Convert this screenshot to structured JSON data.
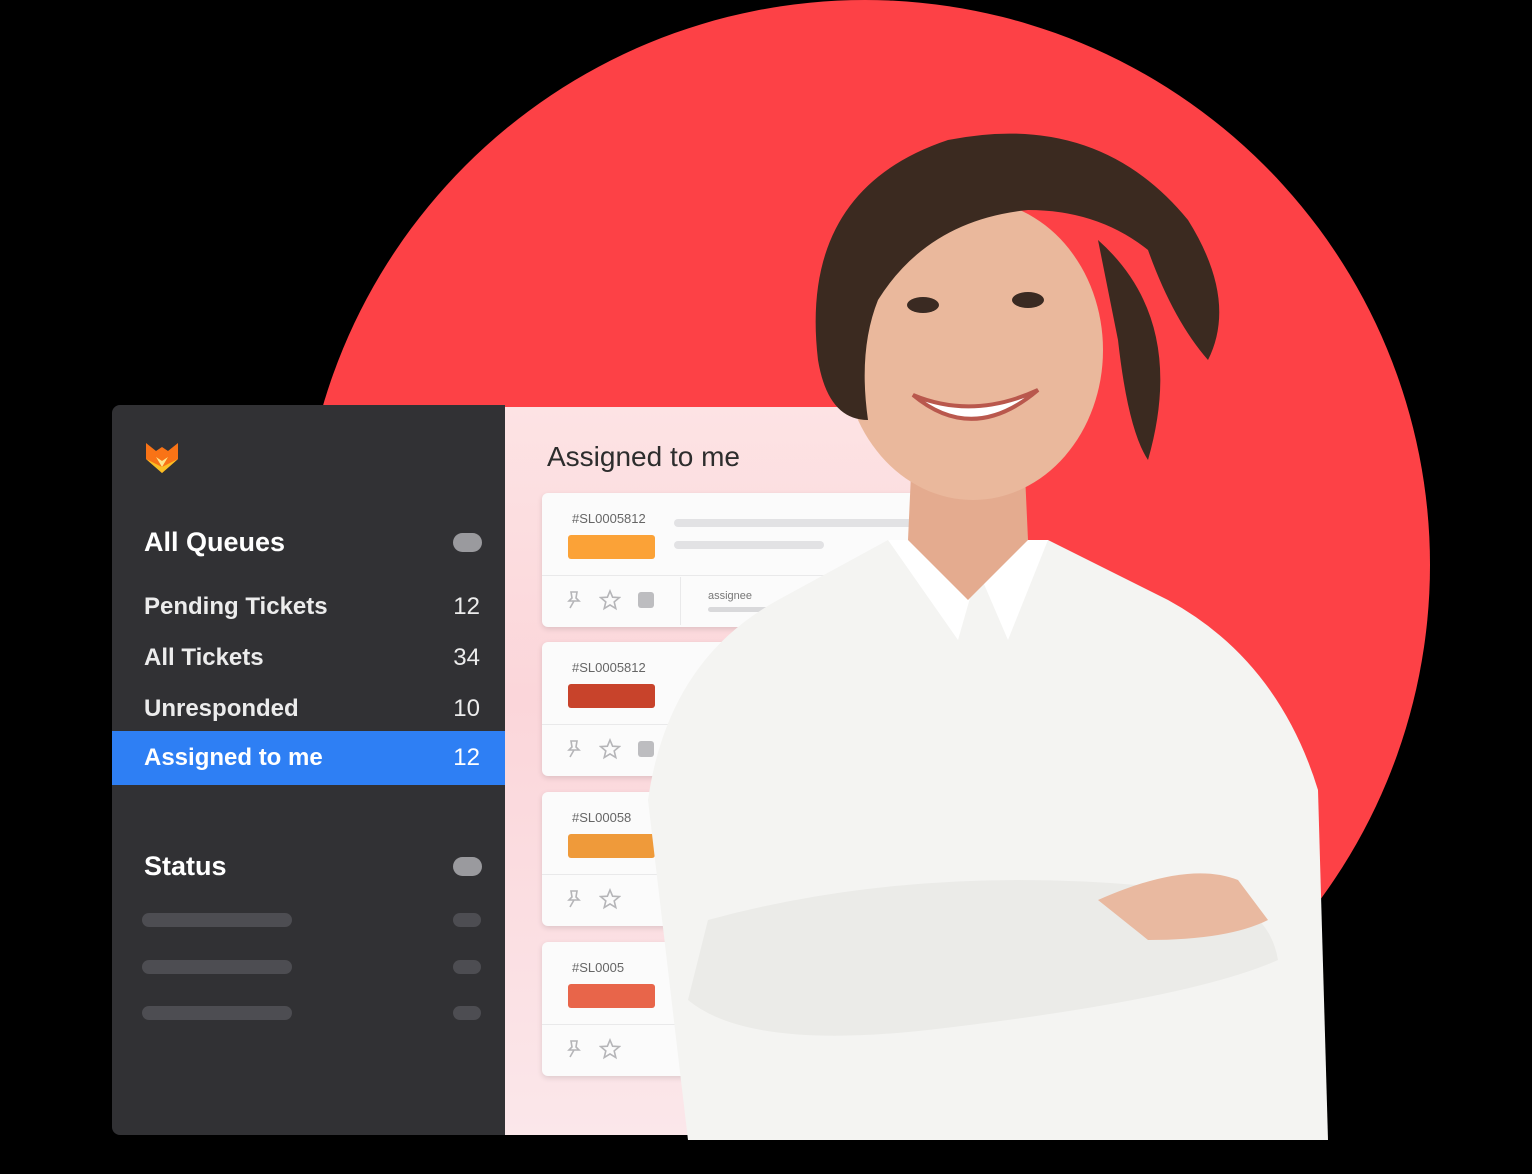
{
  "colors": {
    "accent_circle": "#fd4146",
    "sidebar_bg": "#313134",
    "active_item": "#2e7ff4",
    "priority_colors": [
      "#fba237",
      "#c8432b",
      "#ef9a3a",
      "#e8654a"
    ]
  },
  "sidebar": {
    "logo": "fox-logo-icon",
    "queues_title": "All Queues",
    "items": [
      {
        "label": "Pending Tickets",
        "count": "12"
      },
      {
        "label": "All Tickets",
        "count": "34"
      },
      {
        "label": "Unresponded",
        "count": "10"
      },
      {
        "label": "Assigned to me",
        "count": "12",
        "active": true
      }
    ],
    "status_title": "Status"
  },
  "main": {
    "title": "Assigned to me",
    "tickets": [
      {
        "id": "#SL0005812",
        "assignee_label": "assignee"
      },
      {
        "id": "#SL0005812"
      },
      {
        "id": "#SL00058"
      },
      {
        "id": "#SL0005"
      }
    ]
  }
}
